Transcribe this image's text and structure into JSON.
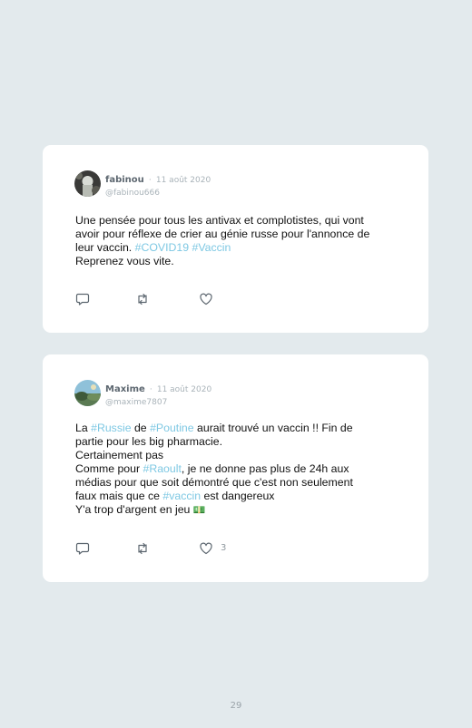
{
  "tweets": [
    {
      "author": "fabinou",
      "separator": "·",
      "date": "11 août 2020",
      "handle": "@fabinou666",
      "avatar_icon": "avatar-photo",
      "lines": [
        [
          "Une pensée pour tous les antivax et complotistes, qui vont"
        ],
        [
          "avoir pour réflexe de crier au génie russe pour l'annonce de"
        ],
        [
          "leur vaccin. ",
          "#COVID19",
          " ",
          "#Vaccin"
        ],
        [
          "Reprenez vous vite."
        ]
      ],
      "actions": {
        "reply_icon": "comment-icon",
        "retweet_icon": "retweet-icon",
        "like_icon": "heart-icon",
        "like_count": ""
      }
    },
    {
      "author": "Maxime",
      "separator": "·",
      "date": "11 août 2020",
      "handle": "@maxime7807",
      "avatar_icon": "avatar-photo",
      "lines": [
        [
          "La ",
          "#Russie",
          " de ",
          "#Poutine",
          " aurait trouvé un vaccin !! Fin de"
        ],
        [
          "partie pour les big pharmacie."
        ],
        [
          "Certainement pas"
        ],
        [
          "Comme pour ",
          "#Raoult",
          ", je ne donne pas plus de 24h aux"
        ],
        [
          "médias pour que soit démontré que c'est non seulement"
        ],
        [
          "faux mais que ce ",
          "#vaccin",
          " est dangereux"
        ],
        [
          "Y'a trop d'argent en jeu ",
          "💵"
        ]
      ],
      "actions": {
        "reply_icon": "comment-icon",
        "retweet_icon": "retweet-icon",
        "like_icon": "heart-icon",
        "like_count": "3"
      }
    }
  ],
  "colors": {
    "background": "#e3eaed",
    "card": "#ffffff",
    "hashtag": "#7ec8e3",
    "muted": "#a9b3b9"
  },
  "page_number": "29"
}
